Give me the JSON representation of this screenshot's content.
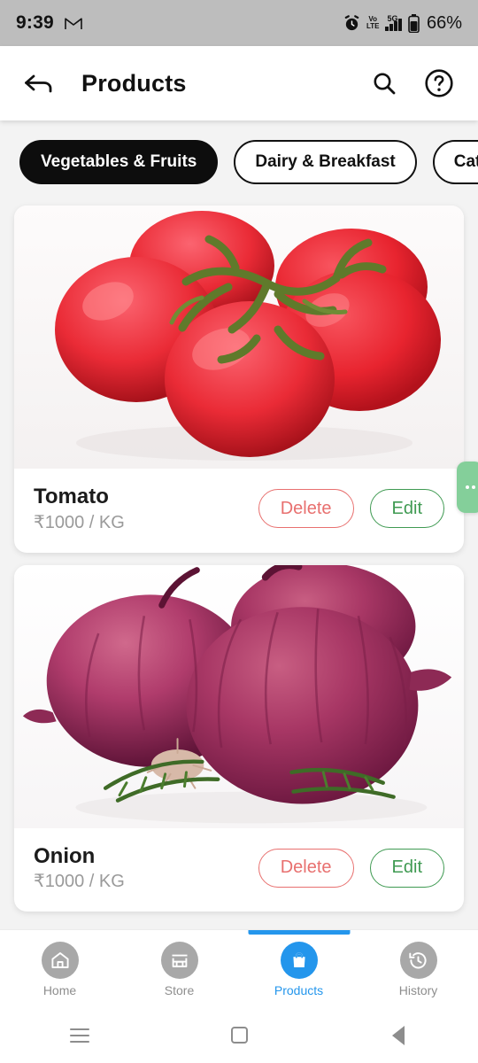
{
  "status_bar": {
    "time": "9:39",
    "app_icon": "gmail-icon",
    "alarm_icon": "alarm-icon",
    "volte_top": "Vo",
    "volte_bottom": "LTE",
    "network": "5G",
    "signal_icon": "signal-bars-icon",
    "battery_icon": "battery-icon",
    "battery": "66%",
    "background_color": "#bdbdbd"
  },
  "app_bar": {
    "back_icon": "back-arrow-icon",
    "title": "Products",
    "search_icon": "search-icon",
    "help_icon": "help-circle-icon"
  },
  "categories": {
    "chips": [
      {
        "label": "Vegetables & Fruits",
        "active": true
      },
      {
        "label": "Dairy & Breakfast",
        "active": false
      },
      {
        "label": "Category",
        "active": false
      }
    ]
  },
  "side_handle": {
    "icon": "more-dots-handle-icon",
    "color": "#84cf9a"
  },
  "products": [
    {
      "name": "Tomato",
      "price": "₹1000 / KG",
      "image": "tomatoes-photo",
      "delete_label": "Delete",
      "edit_label": "Edit"
    },
    {
      "name": "Onion",
      "price": "₹1000 / KG",
      "image": "red-onions-photo",
      "delete_label": "Delete",
      "edit_label": "Edit"
    }
  ],
  "bottom_nav": {
    "items": [
      {
        "label": "Home",
        "icon": "home-icon",
        "active": false
      },
      {
        "label": "Store",
        "icon": "store-icon",
        "active": false
      },
      {
        "label": "Products",
        "icon": "shopping-bag-icon",
        "active": true
      },
      {
        "label": "History",
        "icon": "history-clock-icon",
        "active": false
      }
    ],
    "active_color": "#2496ec",
    "inactive_color": "#a8a8a8"
  },
  "android_nav": {
    "recents_icon": "recents-menu-icon",
    "home_icon": "home-square-icon",
    "back_icon": "back-triangle-icon"
  },
  "colors": {
    "delete": "#e8706f",
    "edit": "#3f9a52",
    "accent": "#2496ec",
    "page_bg": "#f3f3f3"
  }
}
